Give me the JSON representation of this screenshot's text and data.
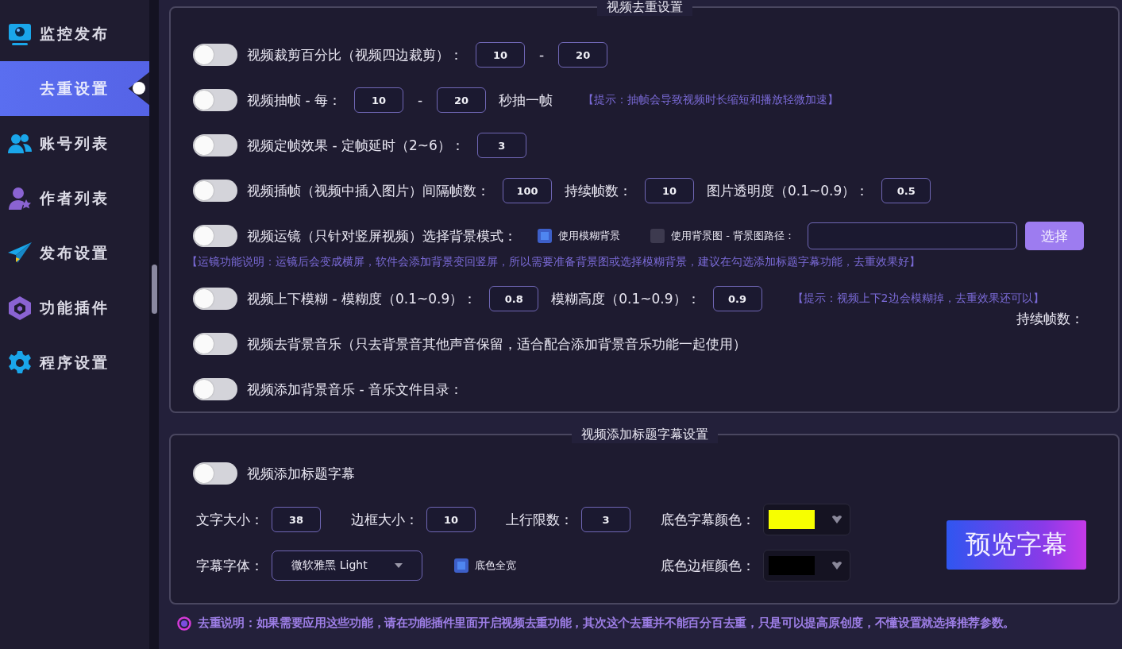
{
  "sidebar": {
    "items": [
      {
        "label": "监控发布",
        "selected": false
      },
      {
        "label": "去重设置",
        "selected": true
      },
      {
        "label": "账号列表",
        "selected": false
      },
      {
        "label": "作者列表",
        "selected": false
      },
      {
        "label": "发布设置",
        "selected": false
      },
      {
        "label": "功能插件",
        "selected": false
      },
      {
        "label": "程序设置",
        "selected": false
      }
    ]
  },
  "dedup": {
    "title": "视频去重设置",
    "rows": [
      {
        "kind": "toggle",
        "on": false,
        "parts": [
          {
            "kind": "text",
            "text": "视频裁剪百分比（视频四边裁剪）："
          },
          {
            "kind": "input",
            "value": "10"
          },
          {
            "kind": "sep",
            "text": "-"
          },
          {
            "kind": "input",
            "value": "20"
          }
        ]
      },
      {
        "kind": "toggle",
        "on": false,
        "parts": [
          {
            "kind": "text",
            "text": "视频抽帧 - 每："
          },
          {
            "kind": "input",
            "value": "10"
          },
          {
            "kind": "sep",
            "text": "-"
          },
          {
            "kind": "input",
            "value": "20"
          },
          {
            "kind": "text",
            "text": "秒抽一帧"
          },
          {
            "kind": "hint",
            "text": "【提示：抽帧会导致视频时长缩短和播放轻微加速】"
          }
        ]
      },
      {
        "kind": "toggle",
        "on": false,
        "parts": [
          {
            "kind": "text",
            "text": "视频定帧效果 - 定帧延时（2~6）："
          },
          {
            "kind": "input",
            "value": "3"
          }
        ]
      },
      {
        "kind": "toggle",
        "on": false,
        "parts": [
          {
            "kind": "text",
            "text": "视频插帧（视频中插入图片）间隔帧数："
          },
          {
            "kind": "input",
            "value": "100"
          },
          {
            "kind": "text",
            "text": "持续帧数："
          },
          {
            "kind": "input",
            "value": "10"
          },
          {
            "kind": "text",
            "text": "图片透明度（0.1~0.9）："
          },
          {
            "kind": "input",
            "value": "0.5"
          }
        ]
      },
      {
        "kind": "toggle",
        "on": false,
        "parts": [
          {
            "kind": "text",
            "text": "视频运镜（只针对竖屏视频）选择背景模式："
          },
          {
            "kind": "checkbox",
            "checked": true,
            "text": "使用模糊背景"
          },
          {
            "kind": "checkbox",
            "checked": false,
            "text": "使用背景图 - 背景图路径："
          },
          {
            "kind": "path"
          },
          {
            "kind": "button",
            "text": "选择"
          }
        ]
      },
      {
        "kind": "note",
        "text": "【运镜功能说明：运镜后会变成横屏，软件会添加背景变回竖屏，所以需要准备背景图或选择模糊背景，建议在勾选添加标题字幕功能，去重效果好】"
      },
      {
        "kind": "toggle",
        "on": false,
        "parts": [
          {
            "kind": "text",
            "text": "视频上下模糊 - 模糊度（0.1~0.9）："
          },
          {
            "kind": "input",
            "value": "0.8"
          },
          {
            "kind": "text",
            "text": "模糊高度（0.1~0.9）："
          },
          {
            "kind": "input",
            "value": "0.9"
          },
          {
            "kind": "hint",
            "text": "【提示：视频上下2边会模糊掉，去重效果还可以】"
          }
        ]
      },
      {
        "kind": "aside",
        "text": "持续帧数："
      },
      {
        "kind": "toggle",
        "on": false,
        "parts": [
          {
            "kind": "text",
            "text": "视频去背景音乐（只去背景音其他声音保留，适合配合添加背景音乐功能一起使用）"
          }
        ]
      },
      {
        "kind": "toggle",
        "on": false,
        "parts": [
          {
            "kind": "text",
            "text": "视频添加背景音乐 - 音乐文件目录："
          }
        ]
      }
    ]
  },
  "subtitle": {
    "title": "视频添加标题字幕设置",
    "toggle": {
      "on": false,
      "text": "视频添加标题字幕"
    },
    "fields": [
      {
        "parts": [
          {
            "kind": "text",
            "text": "文字大小："
          },
          {
            "kind": "input",
            "value": "38"
          },
          {
            "kind": "text",
            "text": "边框大小："
          },
          {
            "kind": "input",
            "value": "10"
          },
          {
            "kind": "text",
            "text": "上行限数："
          },
          {
            "kind": "input",
            "value": "3"
          }
        ]
      },
      {
        "parts": [
          {
            "kind": "text",
            "text": "字幕字体："
          },
          {
            "kind": "select",
            "value": "微软雅黑 Light"
          },
          {
            "kind": "checkbox",
            "checked": true,
            "text": "底色全宽"
          }
        ]
      }
    ],
    "colors": [
      {
        "label": "底色字幕颜色：",
        "color": "#f7ff00"
      },
      {
        "label": "底色边框颜色：",
        "color": "#000000"
      }
    ],
    "preview_button": "预览字幕"
  },
  "footer": "去重说明：如果需要应用这些功能，请在功能插件里面开启视频去重功能，其次这个去重并不能百分百去重，只是可以提高原创度，不懂设置就选择推荐参数。"
}
